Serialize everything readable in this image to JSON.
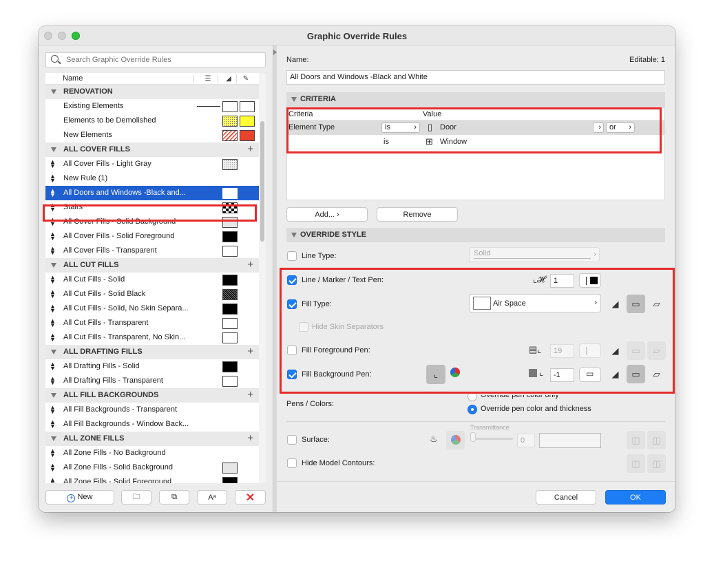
{
  "window": {
    "title": "Graphic Override Rules"
  },
  "search": {
    "placeholder": "Search Graphic Override Rules"
  },
  "list": {
    "header": {
      "name": "Name"
    },
    "rows": [
      {
        "type": "group",
        "label": "RENOVATION"
      },
      {
        "type": "item",
        "label": "Existing Elements"
      },
      {
        "type": "item",
        "label": "Elements to be Demolished"
      },
      {
        "type": "item",
        "label": "New Elements"
      },
      {
        "type": "group",
        "label": "ALL COVER FILLS"
      },
      {
        "type": "item",
        "label": "All Cover Fills - Light Gray"
      },
      {
        "type": "item",
        "label": "New Rule (1)"
      },
      {
        "type": "item",
        "label": "All Doors and Windows -Black and...",
        "selected": true
      },
      {
        "type": "item",
        "label": "Stairs"
      },
      {
        "type": "item",
        "label": "All Cover Fills - Solid Background"
      },
      {
        "type": "item",
        "label": "All Cover Fills - Solid Foreground"
      },
      {
        "type": "item",
        "label": "All Cover Fills - Transparent"
      },
      {
        "type": "group",
        "label": "ALL CUT FILLS"
      },
      {
        "type": "item",
        "label": "All Cut Fills - Solid"
      },
      {
        "type": "item",
        "label": "All Cut Fills - Solid Black"
      },
      {
        "type": "item",
        "label": "All Cut Fills - Solid, No Skin Separa..."
      },
      {
        "type": "item",
        "label": "All Cut Fills - Transparent"
      },
      {
        "type": "item",
        "label": "All Cut Fills - Transparent, No Skin..."
      },
      {
        "type": "group",
        "label": "ALL DRAFTING FILLS"
      },
      {
        "type": "item",
        "label": "All Drafting Fills - Solid"
      },
      {
        "type": "item",
        "label": "All Drafting Fills - Transparent"
      },
      {
        "type": "group",
        "label": "ALL FILL BACKGROUNDS"
      },
      {
        "type": "item",
        "label": "All Fill Backgrounds - Transparent"
      },
      {
        "type": "item",
        "label": "All Fill Backgrounds - Window Back..."
      },
      {
        "type": "group",
        "label": "ALL ZONE FILLS"
      },
      {
        "type": "item",
        "label": "All Zone Fills - No Background"
      },
      {
        "type": "item",
        "label": "All Zone Fills - Solid Background"
      },
      {
        "type": "item",
        "label": "All Zone Fills - Solid Foreground"
      }
    ]
  },
  "left_buttons": {
    "new": "New"
  },
  "detail": {
    "name_label": "Name:",
    "editable_label": "Editable: 1",
    "name_value": "All Doors and Windows -Black and White",
    "criteria_section": "CRITERIA",
    "criteria_header": {
      "criteria": "Criteria",
      "value": "Value"
    },
    "criteria_rows": [
      {
        "criteria": "Element Type",
        "op": "is",
        "value": "Door",
        "logic": "or"
      },
      {
        "criteria": "",
        "op": "is",
        "value": "Window"
      }
    ],
    "add_button": "Add...",
    "remove_button": "Remove",
    "override_section": "OVERRIDE STYLE",
    "line_type_label": "Line Type:",
    "line_type_value": "Solid",
    "line_pen_label": "Line / Marker / Text Pen:",
    "line_pen_value": "1",
    "fill_type_label": "Fill Type:",
    "fill_type_value": "Air Space",
    "hide_skin_label": "Hide Skin Separators",
    "fill_fg_label": "Fill Foreground Pen:",
    "fill_fg_value": "19",
    "fill_bg_label": "Fill Background Pen:",
    "fill_bg_value": "-1",
    "pens_colors_label": "Pens / Colors:",
    "radio_color_only": "Override pen color only",
    "radio_color_thickness": "Override pen color and thickness",
    "transmittance_label": "Transmittance",
    "transmittance_value": "0",
    "surface_label": "Surface:",
    "hide_contours_label": "Hide Model Contours:",
    "cancel_button": "Cancel",
    "ok_button": "OK"
  },
  "colors": {
    "accent": "#1d7df5",
    "selection": "#1f5fcf",
    "highlight": "#e62a2a"
  }
}
